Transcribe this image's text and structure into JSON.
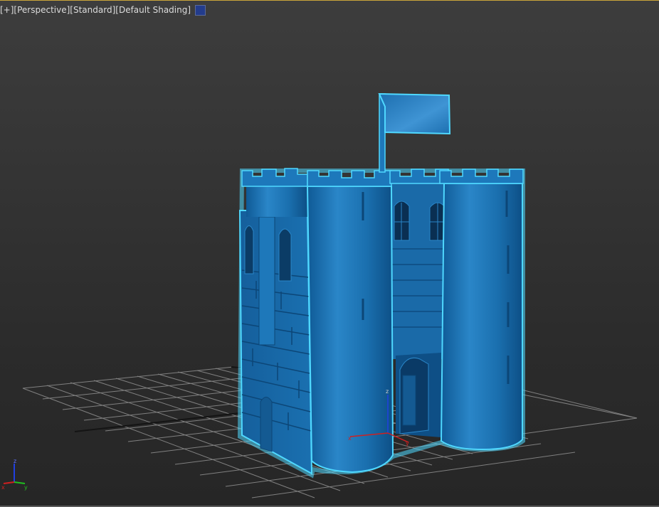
{
  "viewport": {
    "menu_label": "[+]",
    "view_label": "[Perspective]",
    "quality_label": "[Standard]",
    "shading_label": "[Default Shading]",
    "color_swatch": "#233c8c"
  },
  "colors": {
    "background_top": "#3d3d3d",
    "background_bottom": "#262626",
    "grid": "#8a8a8a",
    "model_fill": "#1a6fae",
    "selection_outline": "#4fd8ff",
    "axis_x": "#d02020",
    "axis_y": "#20c020",
    "axis_z": "#2040e0"
  },
  "model": {
    "name": "castle-model",
    "selected": true,
    "shading": "default"
  },
  "gizmo": {
    "x_label": "x",
    "y_label": "y",
    "z_label": "z"
  },
  "icons": [
    "viewport-menu-icon",
    "color-swatch-icon",
    "axis-tripod-icon",
    "transform-gizmo-icon"
  ]
}
